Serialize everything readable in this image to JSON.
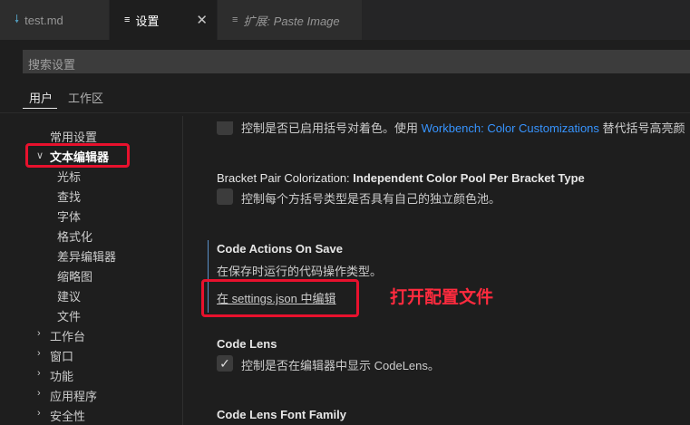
{
  "tabs": [
    {
      "label": "test.md",
      "icon": "markdown-icon"
    },
    {
      "label": "设置",
      "icon": "settings-file-icon",
      "close": "✕"
    },
    {
      "label": "扩展: Paste Image",
      "icon": "extension-preview-icon"
    }
  ],
  "search": {
    "placeholder": "搜索设置"
  },
  "scopes": {
    "user": "用户",
    "workspace": "工作区"
  },
  "toc": {
    "common": "常用设置",
    "text_editor": "文本编辑器",
    "children": [
      "光标",
      "查找",
      "字体",
      "格式化",
      "差异编辑器",
      "缩略图",
      "建议",
      "文件"
    ],
    "groups": [
      "工作台",
      "窗口",
      "功能",
      "应用程序",
      "安全性"
    ]
  },
  "settings": {
    "partial_desc_a": "控制是否已启用括号对着色。使用 ",
    "partial_desc_link": "Workbench: Color Customizations",
    "partial_desc_b": " 替代括号高亮颜",
    "bpc_category": "Bracket Pair Colorization: ",
    "bpc_name": "Independent Color Pool Per Bracket Type",
    "bpc_desc": "控制每个方括号类型是否具有自己的独立颜色池。",
    "cao_title": "Code Actions On Save",
    "cao_desc": "在保存时运行的代码操作类型。",
    "cao_link": "在 settings.json 中编辑",
    "lens_title": "Code Lens",
    "lens_desc": "控制是否在编辑器中显示 CodeLens。",
    "lens_font_title": "Code Lens Font Family"
  },
  "annotation": {
    "text": "打开配置文件"
  },
  "colors": {
    "annotation_red": "#e8112d",
    "link_blue": "#3794ff",
    "background": "#1e1e1e"
  }
}
